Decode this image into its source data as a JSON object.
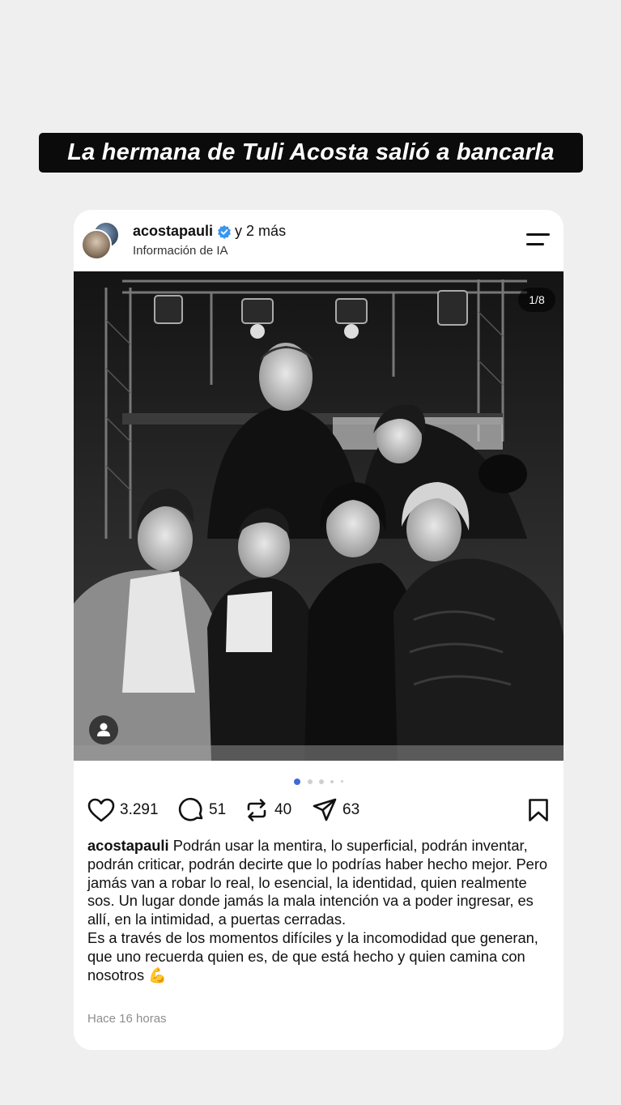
{
  "headline": "La hermana de Tuli Acosta salió a bancarla",
  "post": {
    "username": "acostapauli",
    "coauthors": "y 2 más",
    "subtitle": "Información de IA",
    "image_counter": "1/8",
    "likes": "3.291",
    "comments": "51",
    "reposts": "40",
    "shares": "63",
    "caption_user": "acostapauli",
    "caption_p1": "Podrán usar la mentira, lo superficial, podrán inventar, podrán criticar, podrán decirte que lo podrías haber hecho mejor. Pero jamás van a robar lo real, lo esencial, la identidad, quien realmente sos. Un lugar donde jamás la mala intención va a poder ingresar, es allí, en la intimidad, a puertas cerradas.",
    "caption_p2": "Es a través de los momentos difíciles y la incomodidad que generan, que uno recuerda quien es, de que está hecho y quien camina con nosotros",
    "caption_emoji": "💪",
    "timestamp": "Hace 16 horas"
  },
  "icons": [
    "verified-icon",
    "menu-icon",
    "heart-icon",
    "comment-icon",
    "repost-icon",
    "share-icon",
    "bookmark-icon",
    "user-tag-icon"
  ],
  "colors": {
    "verified": "#3897f0",
    "active_dot": "#3f6ad8",
    "headline_bg": "#0b0b0b"
  }
}
